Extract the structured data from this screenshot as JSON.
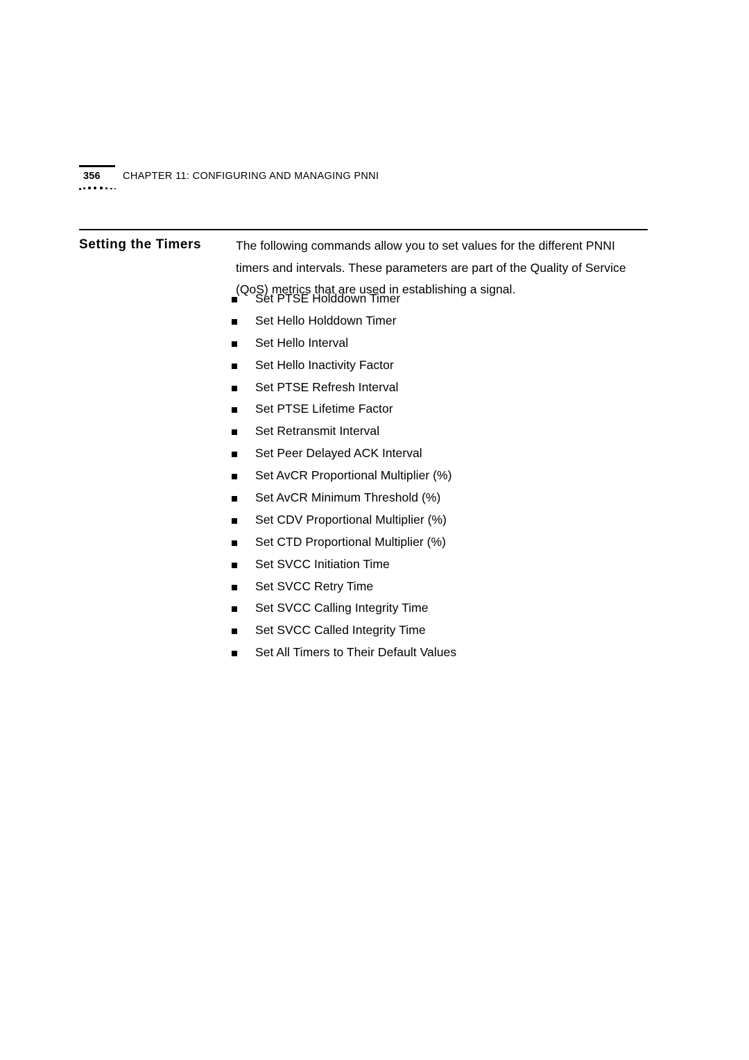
{
  "header": {
    "page_number": "356",
    "chapter_label": "CHAPTER 11: CONFIGURING AND MANAGING PNNI"
  },
  "section": {
    "heading": "Setting the Timers",
    "intro": "The following commands allow you to set values for the different PNNI timers and intervals. These parameters are part of the Quality of Service (QoS) metrics that are used in establishing a signal.",
    "items": [
      "Set PTSE Holddown Timer",
      "Set  Hello Holddown Timer",
      "Set Hello Interval",
      "Set Hello Inactivity Factor",
      "Set PTSE Refresh Interval",
      "Set PTSE Lifetime Factor",
      "Set Retransmit Interval",
      "Set Peer Delayed ACK Interval",
      "Set AvCR Proportional Multiplier (%)",
      "Set AvCR Minimum Threshold (%)",
      "Set CDV Proportional Multiplier (%)",
      "Set CTD Proportional Multiplier (%)",
      "Set SVCC Initiation Time",
      "Set SVCC Retry Time",
      "Set SVCC Calling Integrity Time",
      "Set SVCC Called Integrity Time",
      "Set All Timers to Their Default Values"
    ]
  }
}
